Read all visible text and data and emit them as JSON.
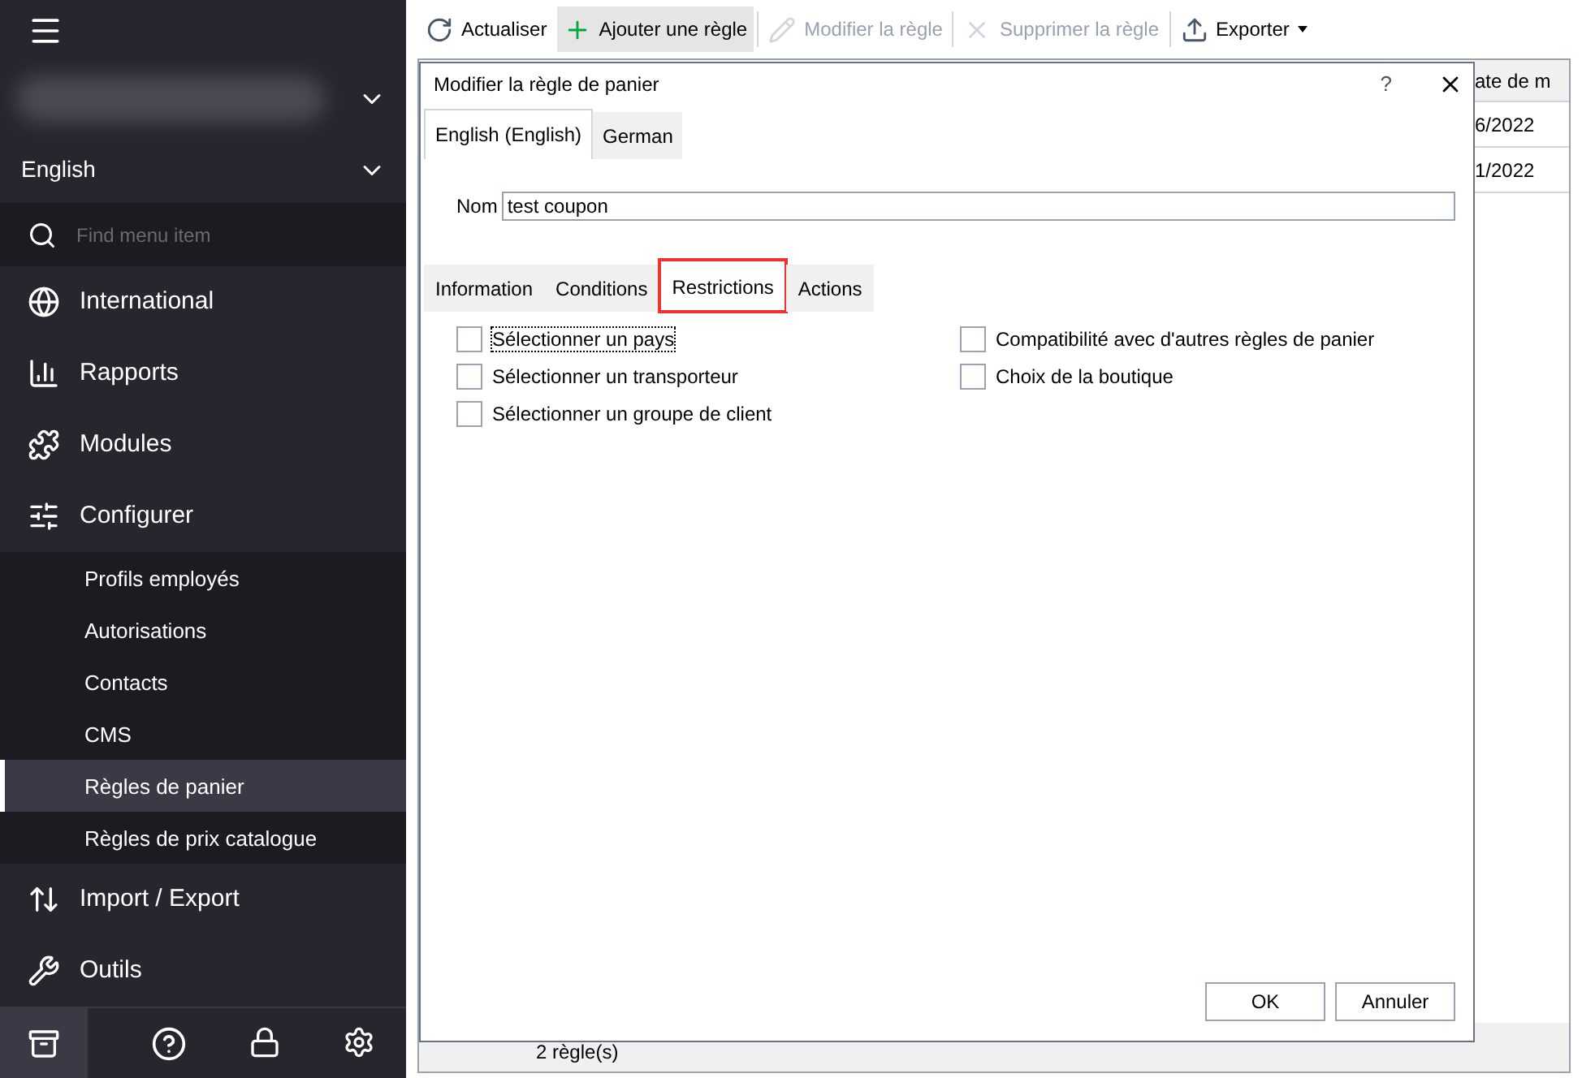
{
  "sidebar": {
    "language": "English",
    "search": {
      "placeholder": "Find menu item"
    },
    "items": [
      {
        "label": "International"
      },
      {
        "label": "Rapports"
      },
      {
        "label": "Modules"
      },
      {
        "label": "Configurer",
        "children": [
          {
            "label": "Profils employés",
            "selected": false
          },
          {
            "label": "Autorisations",
            "selected": false
          },
          {
            "label": "Contacts",
            "selected": false
          },
          {
            "label": "CMS",
            "selected": false
          },
          {
            "label": "Règles de panier",
            "selected": true
          },
          {
            "label": "Règles de prix catalogue",
            "selected": false
          }
        ]
      },
      {
        "label": "Import / Export"
      },
      {
        "label": "Outils"
      }
    ]
  },
  "toolbar": [
    {
      "label": "Actualiser",
      "disabled": false,
      "hovered": false
    },
    {
      "label": "Ajouter une règle",
      "disabled": false,
      "hovered": true
    },
    {
      "label": "Modifier la règle",
      "disabled": true,
      "hovered": false
    },
    {
      "label": "Supprimer la règle",
      "disabled": true,
      "hovered": false
    },
    {
      "label": "Exporter",
      "disabled": false,
      "hovered": false
    }
  ],
  "grid": {
    "column_header": "ate de m",
    "cells": [
      "6/2022",
      "1/2022"
    ],
    "status": "2 règle(s)"
  },
  "dialog": {
    "title": "Modifier la règle de panier",
    "help": "?",
    "language_tabs": [
      {
        "label": "English (English)",
        "selected": true
      },
      {
        "label": "German",
        "selected": false
      }
    ],
    "name_label": "Nom",
    "name_value": "test coupon",
    "tabs": [
      {
        "label": "Information",
        "selected": false,
        "highlighted": false
      },
      {
        "label": "Conditions",
        "selected": false,
        "highlighted": false
      },
      {
        "label": "Restrictions",
        "selected": true,
        "highlighted": true
      },
      {
        "label": "Actions",
        "selected": false,
        "highlighted": false
      }
    ],
    "options_left": [
      {
        "label": "Sélectionner un pays",
        "checked": false,
        "focused": true
      },
      {
        "label": "Sélectionner un transporteur",
        "checked": false,
        "focused": false
      },
      {
        "label": "Sélectionner un groupe de client",
        "checked": false,
        "focused": false
      }
    ],
    "options_right": [
      {
        "label": "Compatibilité avec d'autres règles de panier",
        "checked": false,
        "focused": false
      },
      {
        "label": "Choix de la boutique",
        "checked": false,
        "focused": false
      }
    ],
    "buttons": [
      "OK",
      "Annuler"
    ]
  }
}
